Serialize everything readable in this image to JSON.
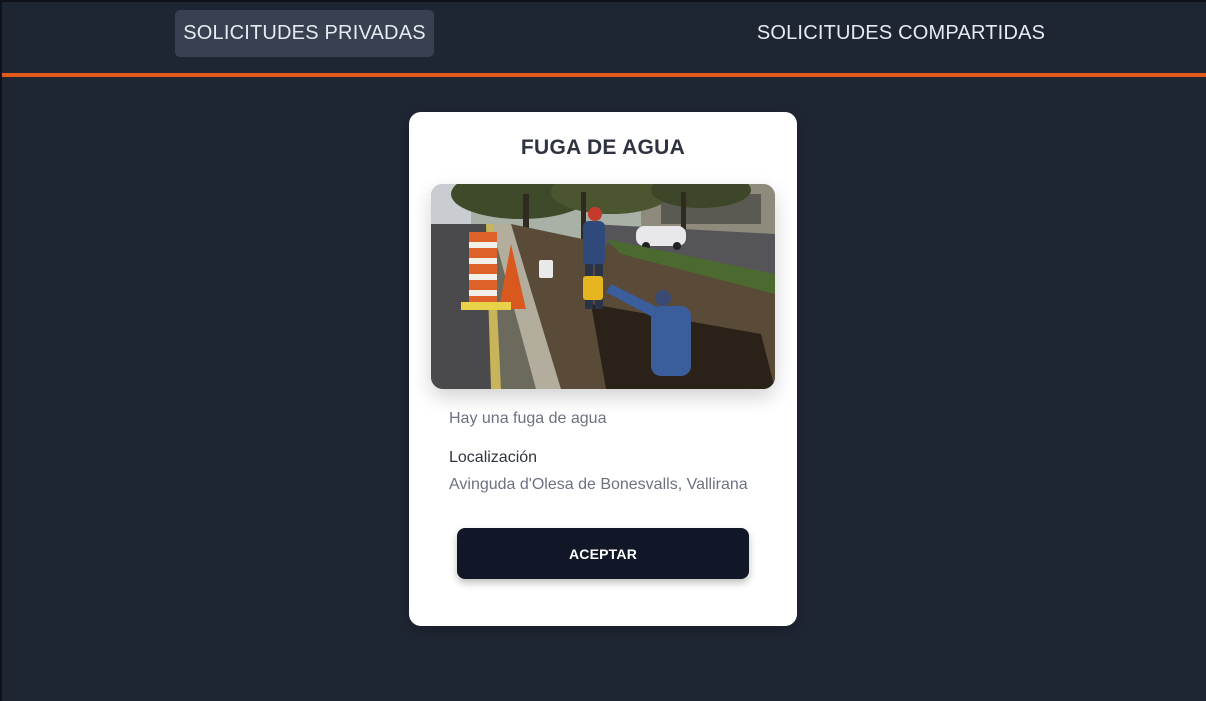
{
  "tabs": [
    {
      "label": "SOLICITUDES PRIVADAS",
      "active": true
    },
    {
      "label": "SOLICITUDES COMPARTIDAS",
      "active": false
    }
  ],
  "colors": {
    "background": "#1f2633",
    "accent_underline": "#e2591a",
    "active_tab": "#374151",
    "button": "#111726"
  },
  "card": {
    "title": "FUGA DE AGUA",
    "image_icon": "street-pipe-repair-photo",
    "description": "Hay una fuga de agua",
    "location_label": "Localización",
    "location_value": "Avinguda d'Olesa de Bonesvalls, Vallirana",
    "accept_label": "ACEPTAR"
  }
}
